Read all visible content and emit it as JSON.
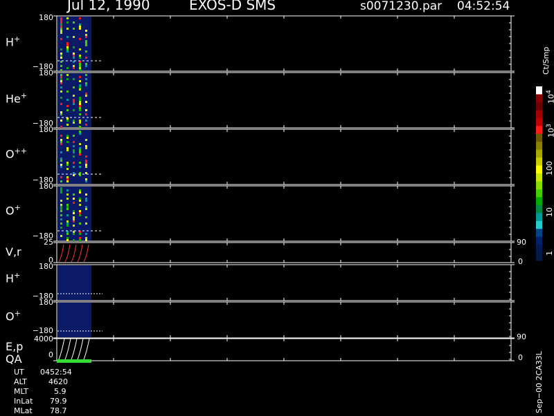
{
  "header": {
    "date": "Jul 12, 1990",
    "instrument": "EXOS-D SMS",
    "file": "s0071230.par",
    "time": "04:52:54"
  },
  "panels": [
    {
      "label": "H",
      "sup": "+",
      "ymax": "180",
      "ymin": "−180"
    },
    {
      "label": "He",
      "sup": "+",
      "ymax": "180",
      "ymin": "−180"
    },
    {
      "label": "O",
      "sup": "++",
      "ymax": "180",
      "ymin": "−180"
    },
    {
      "label": "O",
      "sup": "+",
      "ymax": "180",
      "ymin": "−180"
    },
    {
      "label": "V,r",
      "sup": "",
      "ymax": "25",
      "ymin": "0",
      "rmax": "90",
      "rmin": "0"
    },
    {
      "label": "H",
      "sup": "+",
      "ymax": "180",
      "ymin": "−180"
    },
    {
      "label": "O",
      "sup": "+",
      "ymax": "180",
      "ymin": "−180"
    },
    {
      "label": "E,p",
      "sup": "",
      "ymax": "4000",
      "ymin": "0",
      "rmax": "90",
      "rmin": "0"
    }
  ],
  "qa_label": "QA",
  "colorbar": {
    "title": "Ct/Smp",
    "tick_labels": [
      "10",
      "10",
      "100",
      "10",
      "1"
    ],
    "tick_sups": [
      "4",
      "3",
      "",
      "",
      ""
    ],
    "colors": [
      "#ffffff",
      "#8b0000",
      "#6b0000",
      "#a00000",
      "#c00000",
      "#ff1a1a",
      "#6b5a00",
      "#8a8000",
      "#a8a800",
      "#cccc00",
      "#ffff00",
      "#c8e600",
      "#88dd00",
      "#44cc00",
      "#00aa00",
      "#008844",
      "#009999",
      "#22cccc",
      "#004488",
      "#00226a",
      "#001a55",
      "#001a44"
    ]
  },
  "info": [
    {
      "key": "UT",
      "value": "0452:54"
    },
    {
      "key": "ALT",
      "value": "4620"
    },
    {
      "key": "MLT",
      "value": "5.9"
    },
    {
      "key": "InLat",
      "value": "79.9"
    },
    {
      "key": "MLat",
      "value": "78.7"
    }
  ],
  "footer_id": "Sep−00 2CA33L",
  "chart_data": {
    "type": "heatmap",
    "title": "EXOS-D SMS",
    "panels": [
      "H+",
      "He+",
      "O++",
      "O+",
      "V,r",
      "H+",
      "O+",
      "E,p"
    ],
    "colorscale_label": "Ct/Smp",
    "colorscale_range": [
      1,
      10000
    ],
    "colorscale_log": true,
    "x_extent_fraction_with_data": 0.07
  }
}
